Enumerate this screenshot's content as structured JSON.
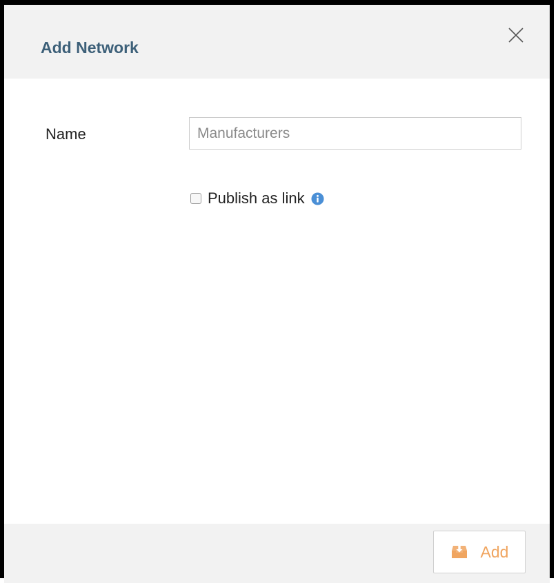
{
  "dialog": {
    "title": "Add Network",
    "close_icon": "close-icon"
  },
  "form": {
    "name_label": "Name",
    "name_input": {
      "value": "",
      "placeholder": "Manufacturers"
    },
    "publish": {
      "label": "Publish as link",
      "checked": false,
      "info_icon": "info-icon"
    }
  },
  "footer": {
    "add_label": "Add",
    "add_icon": "download-tray-icon"
  },
  "colors": {
    "title": "#3d6079",
    "header_bg": "#f2f2f2",
    "accent": "#f0a560",
    "info": "#4a8fd6"
  }
}
